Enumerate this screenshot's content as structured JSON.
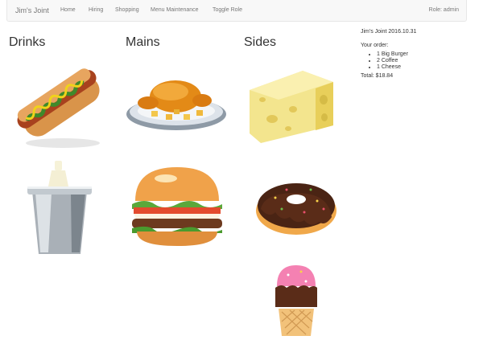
{
  "navbar": {
    "brand": "Jim's Joint",
    "links": [
      "Home",
      "Hiring",
      "Shopping",
      "Menu Maintenance",
      "Toggle Role"
    ],
    "role": "Role: admin"
  },
  "sections": {
    "drinks": "Drinks",
    "mains": "Mains",
    "sides": "Sides"
  },
  "menu_items": [
    "hot-dog",
    "roast-chicken",
    "cheese",
    "milk-bucket",
    "burger",
    "donut",
    "ice-cream"
  ],
  "order": {
    "store": "Jim's Joint 2016.10.31",
    "label": "Your order:",
    "items": [
      "1 Big Burger",
      "2 Coffee",
      "1 Cheese"
    ],
    "total": "Total: $18.84"
  },
  "colors": {
    "navbar_bg": "#f8f8f8",
    "nav_text": "#777777"
  }
}
